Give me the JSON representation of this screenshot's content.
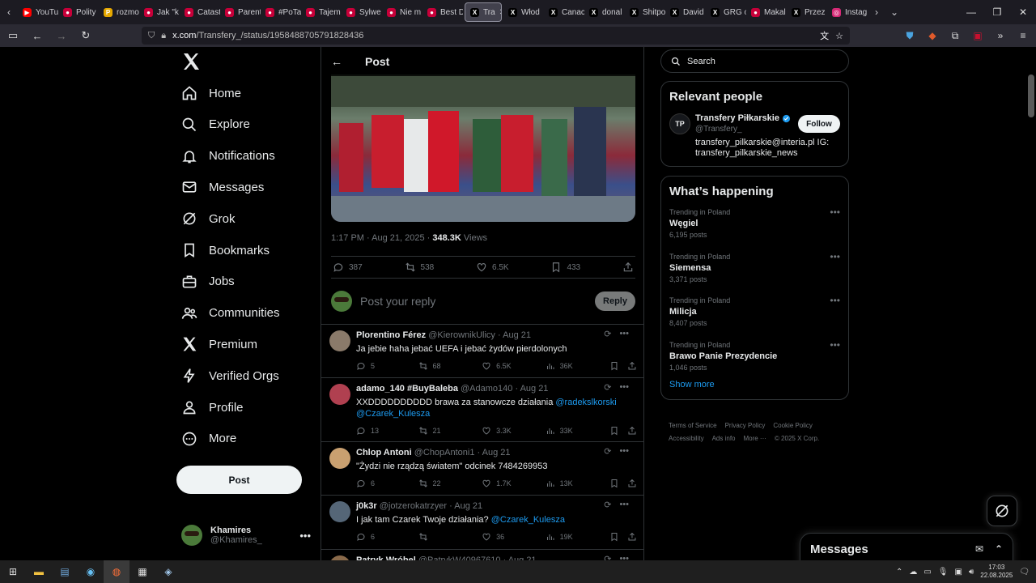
{
  "browser": {
    "tabs": [
      {
        "label": "YouTu",
        "color": "#ff0000",
        "glyph": "▶"
      },
      {
        "label": "Polity",
        "color": "#c70039",
        "glyph": "●"
      },
      {
        "label": "rozmo",
        "color": "#e6a800",
        "glyph": "P"
      },
      {
        "label": "Jak \"k",
        "color": "#c70039",
        "glyph": "●"
      },
      {
        "label": "Catast",
        "color": "#c70039",
        "glyph": "●"
      },
      {
        "label": "Parent",
        "color": "#c70039",
        "glyph": "●"
      },
      {
        "label": "#PoTa",
        "color": "#c70039",
        "glyph": "●"
      },
      {
        "label": "Tajem",
        "color": "#c70039",
        "glyph": "●"
      },
      {
        "label": "Sylwe",
        "color": "#c70039",
        "glyph": "●"
      },
      {
        "label": "Nie m",
        "color": "#c70039",
        "glyph": "●"
      },
      {
        "label": "Best D",
        "color": "#c70039",
        "glyph": "●"
      },
      {
        "label": "Tra",
        "color": "#000000",
        "glyph": "X",
        "active": true
      },
      {
        "label": "Włod",
        "color": "#000000",
        "glyph": "X"
      },
      {
        "label": "Canac",
        "color": "#000000",
        "glyph": "X"
      },
      {
        "label": "donal",
        "color": "#000000",
        "glyph": "X"
      },
      {
        "label": "Shitpo",
        "color": "#000000",
        "glyph": "X"
      },
      {
        "label": "David",
        "color": "#000000",
        "glyph": "X"
      },
      {
        "label": "GRG o",
        "color": "#000000",
        "glyph": "X"
      },
      {
        "label": "Makal",
        "color": "#c70039",
        "glyph": "●"
      },
      {
        "label": "Przez",
        "color": "#000000",
        "glyph": "X"
      },
      {
        "label": "Instag",
        "color": "#d62976",
        "glyph": "◎"
      }
    ],
    "url_host": "x.com",
    "url_path": "/Transfery_/status/1958488705791828436"
  },
  "nav": {
    "items": [
      {
        "label": "Home",
        "icon": "home-icon"
      },
      {
        "label": "Explore",
        "icon": "search-icon"
      },
      {
        "label": "Notifications",
        "icon": "bell-icon"
      },
      {
        "label": "Messages",
        "icon": "mail-icon"
      },
      {
        "label": "Grok",
        "icon": "grok-icon"
      },
      {
        "label": "Bookmarks",
        "icon": "bookmark-icon"
      },
      {
        "label": "Jobs",
        "icon": "briefcase-icon"
      },
      {
        "label": "Communities",
        "icon": "people-icon"
      },
      {
        "label": "Premium",
        "icon": "x-icon"
      },
      {
        "label": "Verified Orgs",
        "icon": "lightning-icon"
      },
      {
        "label": "Profile",
        "icon": "person-icon"
      },
      {
        "label": "More",
        "icon": "more-circle-icon"
      }
    ],
    "post_label": "Post",
    "me": {
      "name": "Khamires",
      "handle": "@Khamires_"
    }
  },
  "post": {
    "header": "Post",
    "time": "1:17 PM · Aug 21, 2025 · ",
    "views_count": "348.3K",
    "views_label": " Views",
    "replies": "387",
    "reposts": "538",
    "likes": "6.5K",
    "bookmarks": "433",
    "reply_placeholder": "Post your reply",
    "reply_button": "Reply"
  },
  "replies": [
    {
      "name": "Plorentino Férez",
      "handle": "@KierownikUlicy",
      "date": "Aug 21",
      "text": "Ja jebie haha jebać UEFA i jebać żydów pierdolonych",
      "link": "",
      "link2": "",
      "replies": "5",
      "reposts": "68",
      "likes": "6.5K",
      "views": "36K"
    },
    {
      "name": "adamo_140 #BuyBaleba",
      "handle": "@Adamo140",
      "date": "Aug 21",
      "text": "XXDDDDDDDDDD brawa za stanowcze działania ",
      "link": "@radekslkorski",
      "link2": "@Czarek_Kulesza",
      "replies": "13",
      "reposts": "21",
      "likes": "3.3K",
      "views": "33K"
    },
    {
      "name": "Chlop Antoni",
      "handle": "@ChopAntoni1",
      "date": "Aug 21",
      "text": "\"Żydzi nie rządzą światem\" odcinek 7484269953",
      "link": "",
      "link2": "",
      "replies": "6",
      "reposts": "22",
      "likes": "1.7K",
      "views": "13K"
    },
    {
      "name": "j0k3r",
      "handle": "@jotzerokatrzyer",
      "date": "Aug 21",
      "text": "I jak tam Czarek Twoje działania? ",
      "link": "@Czarek_Kulesza",
      "link2": "",
      "replies": "6",
      "reposts": "",
      "likes": "36",
      "views": "19K"
    },
    {
      "name": "Patryk Wróbel",
      "handle": "@PatrykW40967610",
      "date": "Aug 21",
      "text": "",
      "link": "",
      "link2": "",
      "replies": "",
      "reposts": "",
      "likes": "",
      "views": ""
    }
  ],
  "right": {
    "search_placeholder": "Search",
    "relevant_title": "Relevant people",
    "person": {
      "name": "Transfery Piłkarskie",
      "handle": "@Transfery_",
      "bio": "transfery_pilkarskie@interia.pl IG: transfery_pilkarskie_news",
      "follow": "Follow",
      "avatar_text": "TP"
    },
    "happening_title": "What’s happening",
    "trends": [
      {
        "context": "Trending in Poland",
        "name": "Węgiel",
        "posts": "6,195 posts"
      },
      {
        "context": "Trending in Poland",
        "name": "Siemensa",
        "posts": "3,371 posts"
      },
      {
        "context": "Trending in Poland",
        "name": "Milicja",
        "posts": "8,407 posts"
      },
      {
        "context": "Trending in Poland",
        "name": "Brawo Panie Prezydencie",
        "posts": "1,046 posts"
      }
    ],
    "show_more": "Show more",
    "footer": [
      "Terms of Service",
      "Privacy Policy",
      "Cookie Policy",
      "Accessibility",
      "Ads info",
      "More ···",
      "© 2025 X Corp."
    ]
  },
  "messages_dock": {
    "title": "Messages"
  },
  "taskbar": {
    "time": "17:03",
    "date": "22.08.2025"
  },
  "colors": {
    "accent": "#1d9bf0",
    "bg": "#000000",
    "border": "#2f3336",
    "muted": "#71767b"
  }
}
